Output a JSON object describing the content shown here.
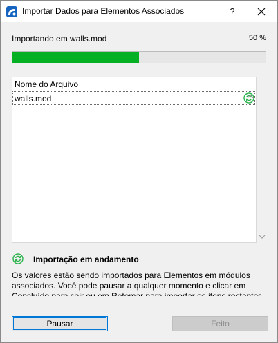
{
  "window": {
    "title": "Importar Dados para Elementos Associados",
    "help_label": "?",
    "close_label": "✕"
  },
  "progress": {
    "label": "Importando em walls.mod",
    "percent_text": "50 %",
    "value": 0.5,
    "fill_color": "#06b025"
  },
  "file_list": {
    "column_header": "Nome do Arquivo",
    "rows": [
      {
        "name": "walls.mod",
        "status_icon": "sync-icon"
      }
    ]
  },
  "status": {
    "icon": "sync-icon",
    "title": "Importação em andamento",
    "description": "Os valores estão sendo importados para Elementos em módulos associados. Você pode pausar a qualquer momento e clicar em Concluído para sair ou em Retomar para importar os itens restantes."
  },
  "buttons": {
    "pause_label": "Pausar",
    "done_label": "Feito"
  },
  "colors": {
    "accent": "#0078d7",
    "success": "#06b025",
    "sync_icon": "#2bb24c"
  }
}
